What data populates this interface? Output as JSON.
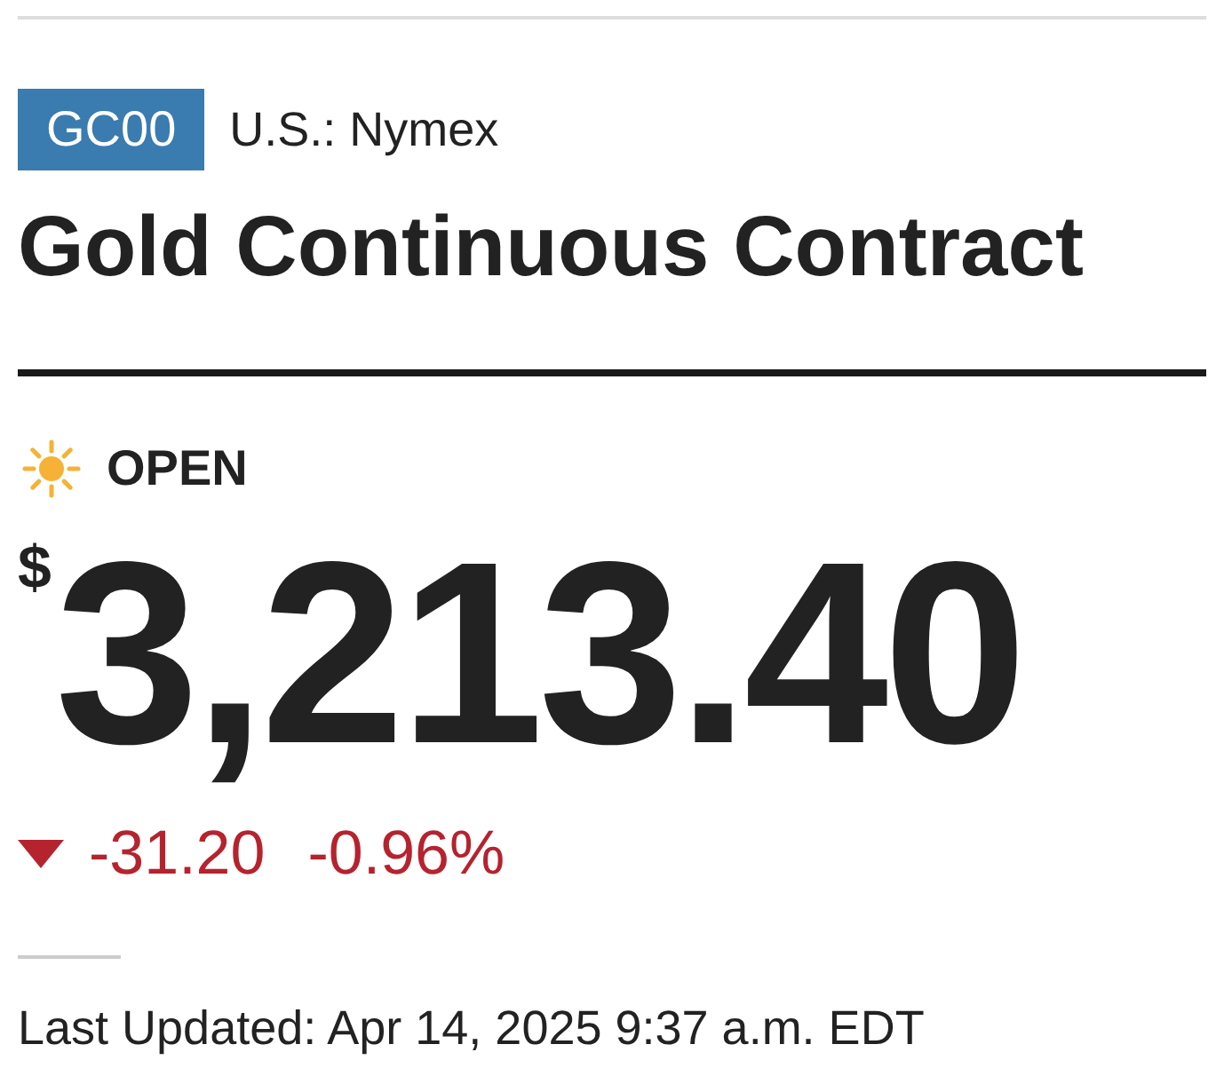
{
  "symbol": "GC00",
  "exchange": "U.S.: Nymex",
  "title": "Gold Continuous Contract",
  "market_status": {
    "kind": "open",
    "label": "OPEN"
  },
  "price": {
    "currency": "$",
    "value": "3,213.40"
  },
  "change": {
    "falling": true,
    "amount": "-31.20",
    "percent": "-0.96%"
  },
  "last_updated": "Last Updated: Apr 14, 2025 9:37 a.m. EDT"
}
